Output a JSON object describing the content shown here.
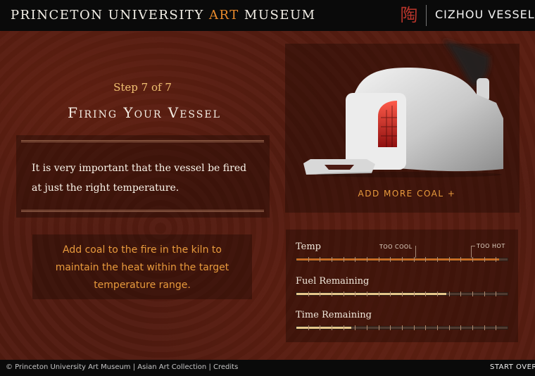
{
  "header": {
    "museum_name_start": "PRINCETON UNIVERSITY ",
    "museum_name_accent": "ART",
    "museum_name_end": " MUSEUM",
    "seal_glyph": "陶",
    "vessel_title": "CIZHOU VESSEL"
  },
  "step": {
    "label": "Step 7 of 7",
    "title": "Firing Your Vessel",
    "intro": "It is very important that the vessel be fired at just the right temperature.",
    "instruction": "Add coal to the fire in the kiln to maintain the heat within the target temperature range."
  },
  "kiln": {
    "action_label": "ADD MORE COAL +"
  },
  "meters": {
    "temp": {
      "label": "Temp",
      "level": 0.96,
      "too_cool_label": "TOO COOL",
      "too_hot_label": "TOO HOT",
      "too_cool_at": 0.56,
      "too_hot_at": 0.83
    },
    "fuel": {
      "label": "Fuel Remaining",
      "level": 0.71
    },
    "time": {
      "label": "Time Remaining",
      "level": 0.26
    }
  },
  "footer": {
    "credits": "© Princeton University Art Museum | Asian Art Collection | Credits",
    "start_over": "START OVER"
  },
  "colors": {
    "accent_orange": "#e88a2c",
    "temp_fill": "#c96a22",
    "fuel_fill": "#e6c68a",
    "time_fill": "#e6c68a"
  }
}
